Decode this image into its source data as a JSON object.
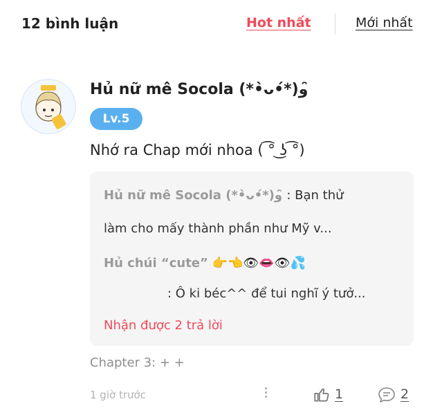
{
  "header": {
    "count_label": "12 bình luận",
    "tab_hot": "Hot nhất",
    "tab_new": "Mới nhất"
  },
  "comment": {
    "username": "Hủ nữ mê Socola (*•̀ᴗ•́*)و ̑̑",
    "level": "Lv.5",
    "text": "Nhớ ra Chap mới nhoa ( ͡° ͜ʖ ͡°)",
    "replies": [
      {
        "name": "Hủ nữ mê Socola (*•̀ᴗ•́*)و ̑̑",
        "text": ": Bạn thử",
        "text2": "làm cho mấy thành phần như Mỹ v..."
      },
      {
        "name": "Hủ chúi “cute”",
        "emoji": "👉👈👁👄👁💦",
        "text": ": Ô ki béc^^ để tui nghĩ ý tưở..."
      }
    ],
    "more_replies": "Nhận được 2 trả lời",
    "chapter": "Chapter 3: + +",
    "time": "1 giờ trước",
    "likes": "1",
    "reply_count": "2"
  },
  "colors": {
    "accent": "#ef4a5a",
    "level_badge": "#5ab0ef",
    "reply_bg": "#f5f5f5"
  },
  "icons": {
    "more": "more-vertical-icon",
    "like": "thumbs-up-icon",
    "reply": "chat-bubble-icon"
  }
}
